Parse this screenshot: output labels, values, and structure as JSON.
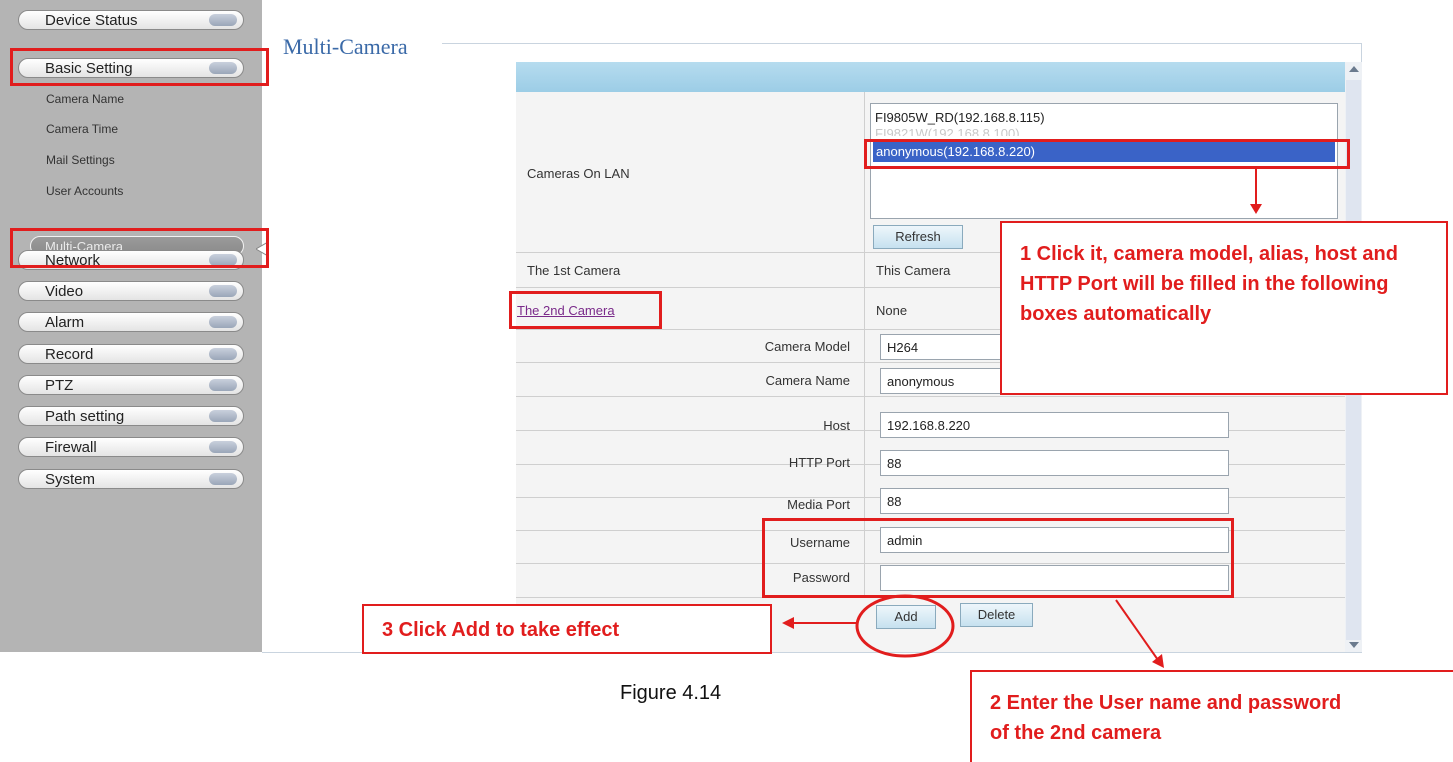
{
  "sidebar": {
    "menus": [
      "Device Status",
      "Basic Setting"
    ],
    "submenu": [
      "Camera Name",
      "Camera Time",
      "Mail Settings",
      "User Accounts"
    ],
    "active_item": "Multi-Camera",
    "menus_after": [
      "Network",
      "Video",
      "Alarm",
      "Record",
      "PTZ",
      "Path setting",
      "Firewall",
      "System"
    ]
  },
  "page": {
    "title": "Multi-Camera"
  },
  "table": {
    "cameras_on_lan_label": "Cameras On LAN",
    "lan_list": [
      "FI9805W_RD(192.168.8.115)",
      "FI9821W(192.168.8.100)",
      "anonymous(192.168.8.220)"
    ],
    "selected_index": 2,
    "refresh_button": "Refresh",
    "first_camera_label": "The 1st Camera",
    "first_camera_value": "This Camera",
    "second_camera_label": "The 2nd Camera",
    "second_camera_value": "None",
    "fields": {
      "camera_model": {
        "label": "Camera Model",
        "value": "H264"
      },
      "camera_name": {
        "label": "Camera Name",
        "value": "anonymous"
      },
      "host": {
        "label": "Host",
        "value": "192.168.8.220"
      },
      "http_port": {
        "label": "HTTP Port",
        "value": "88"
      },
      "media_port": {
        "label": "Media Port",
        "value": "88"
      },
      "username": {
        "label": "Username",
        "value": "admin"
      },
      "password": {
        "label": "Password",
        "value": ""
      }
    },
    "add_button": "Add",
    "delete_button": "Delete"
  },
  "annotations": {
    "step1": "1 Click it, camera model, alias, host and HTTP Port will be filled in the following boxes automatically",
    "step2": "2 Enter the User name and password of the 2nd camera",
    "step3": "3 Click Add to take effect",
    "highlight_color": "#e11d1d"
  },
  "caption": "Figure 4.14"
}
